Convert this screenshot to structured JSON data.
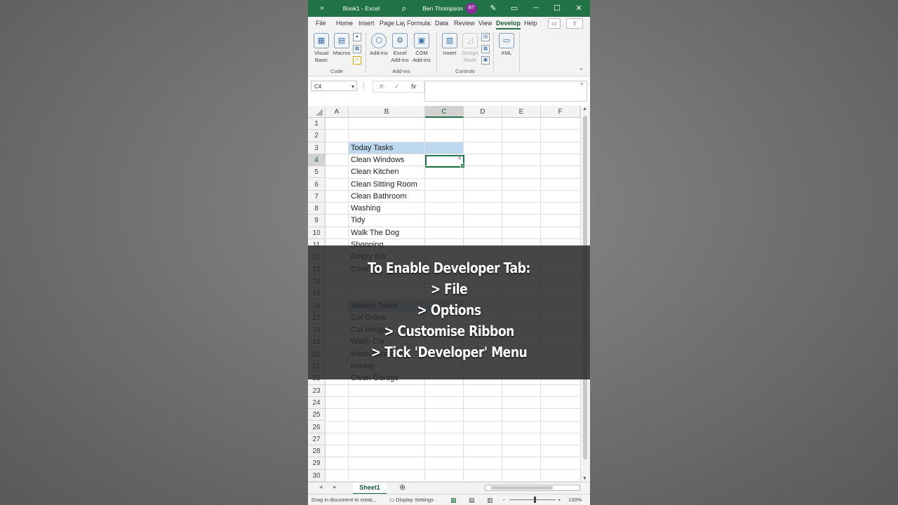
{
  "titlebar": {
    "expand_glyph": "»",
    "title": "Book1  -  Excel",
    "search_glyph": "⌕",
    "user_name": "Ben Thompson",
    "user_initials": "BT",
    "pen_glyph": "✎",
    "ribbon_glyph": "▭",
    "minimize_glyph": "─",
    "maximize_glyph": "☐",
    "close_glyph": "✕"
  },
  "ribbon_tabs": [
    "File",
    "Home",
    "Insert",
    "Page Lay",
    "Formula:",
    "Data",
    "Review",
    "View",
    "Develop",
    "Help"
  ],
  "ribbon_tab_icons": {
    "comment": "▭",
    "share": "⇪"
  },
  "ribbon": {
    "groups": [
      {
        "name": "Code",
        "buttons": [
          "Visual Basic",
          "Macros"
        ]
      },
      {
        "name": "Add-ins",
        "buttons": [
          "Add-ins",
          "Excel Add-ins",
          "COM Add-ins"
        ]
      },
      {
        "name": "Controls",
        "buttons": [
          "Insert",
          "Design Mode"
        ]
      },
      {
        "name": "",
        "buttons": [
          "XML"
        ]
      }
    ],
    "collapse_glyph": "⌃"
  },
  "formula_bar": {
    "name_box": "C4",
    "dropdown_glyph": "▾",
    "separator_glyph": "⁝",
    "cancel_glyph": "✕",
    "enter_glyph": "✓",
    "fx_label": "fx",
    "expand_glyph": "⌃",
    "value": ""
  },
  "grid": {
    "columns": [
      "A",
      "B",
      "C",
      "D",
      "E",
      "F"
    ],
    "selected_column": "C",
    "selected_row": 4,
    "active_cell": "C4",
    "rows": [
      1,
      2,
      3,
      4,
      5,
      6,
      7,
      8,
      9,
      10,
      11,
      12,
      13,
      14,
      15,
      16,
      17,
      18,
      19,
      20,
      21,
      22,
      23,
      24,
      25,
      26,
      27,
      28,
      29,
      30
    ],
    "cells_b": [
      {
        "row": 3,
        "text": "Today Tasks",
        "highlight": true
      },
      {
        "row": 4,
        "text": "Clean Windows"
      },
      {
        "row": 5,
        "text": "Clean Kitchen"
      },
      {
        "row": 6,
        "text": "Clean Sitting Room"
      },
      {
        "row": 7,
        "text": "Clean Bathroom"
      },
      {
        "row": 8,
        "text": "Washing"
      },
      {
        "row": 9,
        "text": "Tidy"
      },
      {
        "row": 10,
        "text": "Walk The Dog"
      },
      {
        "row": 11,
        "text": "Shopping"
      },
      {
        "row": 12,
        "text": "Empty Bin"
      },
      {
        "row": 13,
        "text": "Cooking"
      },
      {
        "row": 16,
        "text": "Weekly Tasks",
        "highlight": true
      },
      {
        "row": 17,
        "text": "Cut Grass"
      },
      {
        "row": 18,
        "text": "Cut Hedges"
      },
      {
        "row": 19,
        "text": "Wash Car"
      },
      {
        "row": 20,
        "text": "Wash Windows"
      },
      {
        "row": 21,
        "text": "Ironing"
      },
      {
        "row": 22,
        "text": "Clean Garage"
      }
    ],
    "highlight_color": "#bdd7ee"
  },
  "sheet_tabs": {
    "prev_glyph": "◂",
    "next_glyph": "▸",
    "active": "Sheet1",
    "add_glyph": "⊕"
  },
  "status_bar": {
    "status_text": "Drag in document to creat...",
    "display_settings": "Display Settings",
    "zoom_minus": "−",
    "zoom_plus": "+",
    "zoom": "130%"
  },
  "overlay_lines": [
    "To Enable Developer Tab:",
    "> File",
    "> Options",
    "> Customise Ribbon",
    "> Tick 'Developer' Menu"
  ],
  "colors": {
    "excel_green": "#217346",
    "avatar": "#8a2c9a"
  }
}
